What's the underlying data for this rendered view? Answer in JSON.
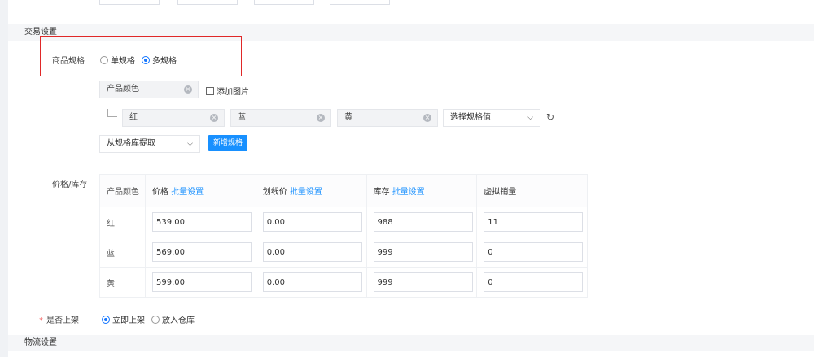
{
  "top_inputs": [
    "",
    "",
    "",
    ""
  ],
  "sections": {
    "trade": "交易设置",
    "logistics": "物流设置"
  },
  "spec": {
    "label": "商品规格",
    "options": [
      "单规格",
      "多规格"
    ],
    "selected": "多规格"
  },
  "spec_group": {
    "name": "产品颜色",
    "add_image": "添加图片",
    "values": [
      "红",
      "蓝",
      "黄"
    ],
    "value_select": "选择规格值",
    "library_select": "从规格库提取",
    "add_button": "新增规格"
  },
  "price_stock": {
    "label": "价格/库存",
    "headers": {
      "color": "产品颜色",
      "price": "价格",
      "strike": "划线价",
      "stock": "库存",
      "virtual": "虚拟销量",
      "batch": "批量设置"
    },
    "rows": [
      {
        "color": "红",
        "price": "539.00",
        "strike": "0.00",
        "stock": "988",
        "virtual": "11"
      },
      {
        "color": "蓝",
        "price": "569.00",
        "strike": "0.00",
        "stock": "999",
        "virtual": "0"
      },
      {
        "color": "黄",
        "price": "599.00",
        "strike": "0.00",
        "stock": "999",
        "virtual": "0"
      }
    ]
  },
  "listing": {
    "required_mark": "*",
    "label": "是否上架",
    "options": [
      "立即上架",
      "放入仓库"
    ],
    "selected": "立即上架"
  },
  "colors": {
    "accent": "#1890ff",
    "highlight_border": "#e02828",
    "required": "#f56c6c"
  }
}
